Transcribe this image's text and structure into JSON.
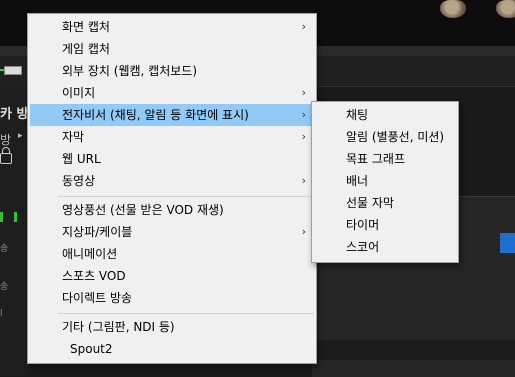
{
  "background": {
    "broadcast_label": "카 방송",
    "row_label": "방",
    "row_arrow": "▸",
    "side_chars": [
      "송",
      "송",
      "l"
    ]
  },
  "main_menu": {
    "items": [
      {
        "label": "화면 캡처",
        "arrow": "›"
      },
      {
        "label": "게임 캡처"
      },
      {
        "label": "외부 장치 (웹캠, 캡처보드)"
      },
      {
        "label": "이미지",
        "arrow": "›"
      },
      {
        "label": "전자비서 (채팅, 알림 등 화면에 표시)",
        "arrow": "›",
        "highlighted": true
      },
      {
        "label": "자막",
        "arrow": "›"
      },
      {
        "label": "웹 URL"
      },
      {
        "label": "동영상",
        "arrow": "›"
      },
      {
        "label": "영상풍선 (선물 받은 VOD 재생)"
      },
      {
        "label": "지상파/케이블",
        "arrow": "›"
      },
      {
        "label": "애니메이션"
      },
      {
        "label": "스포츠 VOD"
      },
      {
        "label": "다이렉트 방송"
      },
      {
        "label": "기타 (그림판, NDI 등)"
      },
      {
        "label": "Spout2"
      }
    ]
  },
  "sub_menu": {
    "items": [
      {
        "label": "채팅"
      },
      {
        "label": "알림 (별풍선, 미션)"
      },
      {
        "label": "목표 그래프"
      },
      {
        "label": "배너"
      },
      {
        "label": "선물 자막"
      },
      {
        "label": "타이머"
      },
      {
        "label": "스코어"
      }
    ]
  },
  "colors": {
    "menu_bg": "#f0f0f0",
    "highlight": "#91c9f7",
    "accent_blue": "#1f6fcf",
    "meter_green": "#3bd14a"
  }
}
